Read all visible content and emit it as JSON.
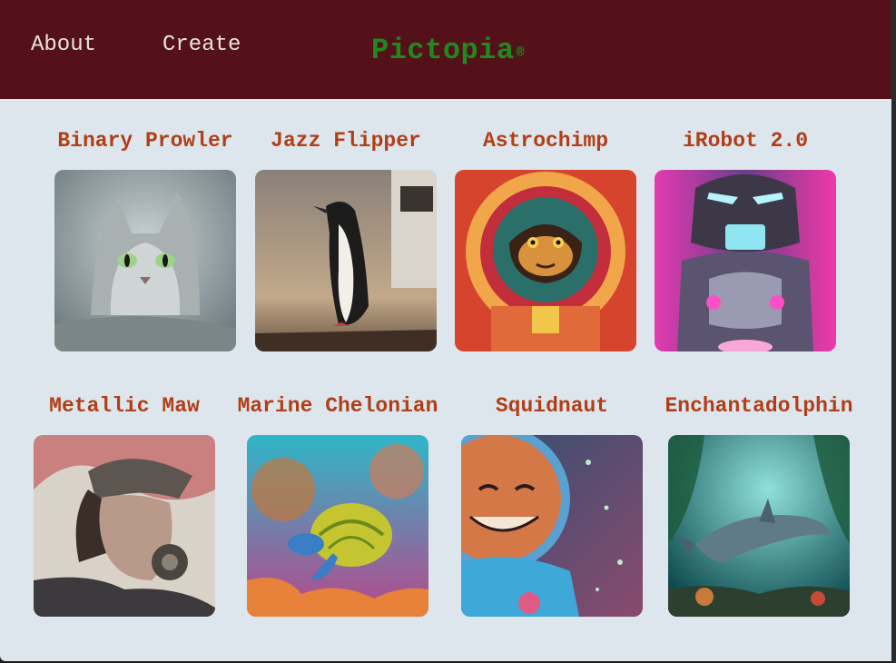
{
  "nav": {
    "about_label": "About",
    "create_label": "Create"
  },
  "brand": {
    "name": "Pictopia",
    "mark": "®"
  },
  "gallery": {
    "items": [
      {
        "title": "Binary Prowler",
        "subject": "cat-icon"
      },
      {
        "title": "Jazz Flipper",
        "subject": "penguin-icon"
      },
      {
        "title": "Astrochimp",
        "subject": "chimp-astronaut-icon"
      },
      {
        "title": "iRobot 2.0",
        "subject": "robot-icon"
      },
      {
        "title": "Metallic Maw",
        "subject": "masked-figure-icon"
      },
      {
        "title": "Marine Chelonian",
        "subject": "sea-turtle-icon"
      },
      {
        "title": "Squidnaut",
        "subject": "squid-astronaut-icon"
      },
      {
        "title": "Enchantadolphin",
        "subject": "dolphin-icon"
      }
    ]
  },
  "colors": {
    "header_bg": "#551119",
    "page_bg": "#dde6ec",
    "brand_green": "#1e8a1e",
    "title_orange": "#b23e17",
    "nav_text": "#e8e2df"
  }
}
